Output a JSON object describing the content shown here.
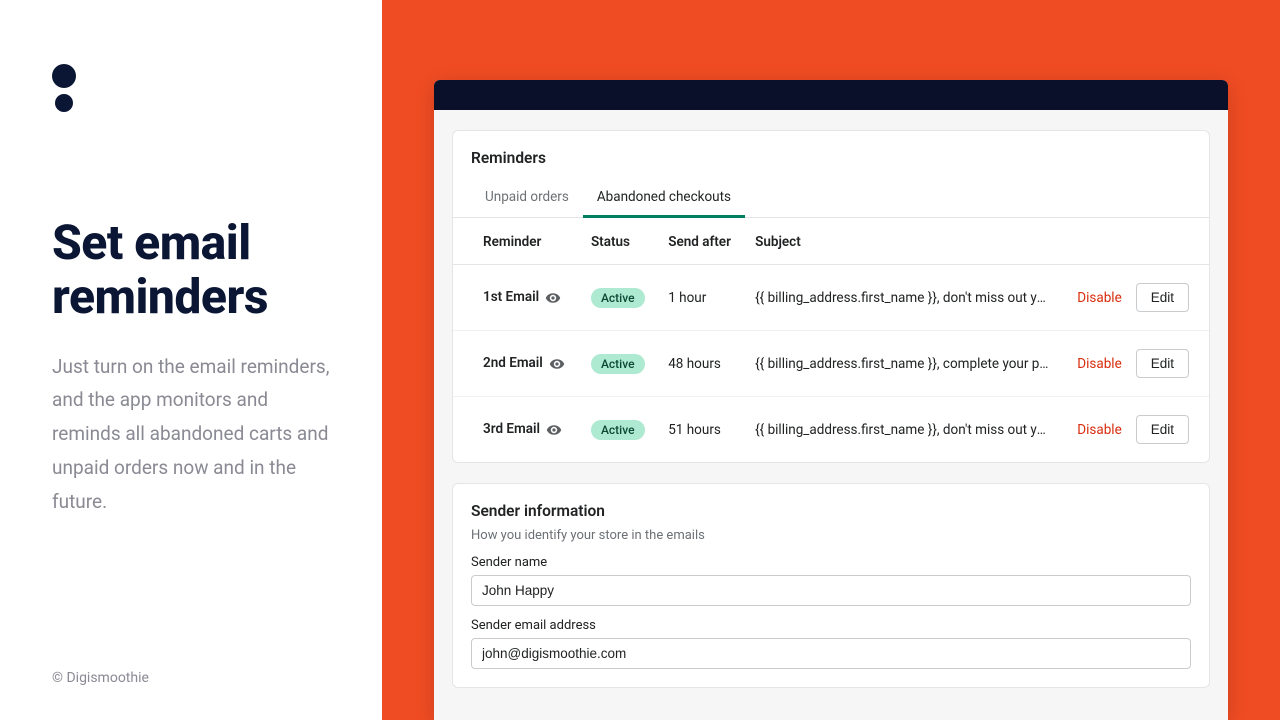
{
  "hero": {
    "title": "Set email reminders",
    "desc": "Just turn on the email reminders, and the app monitors and reminds all abandoned carts and unpaid orders now and in the future.",
    "copyright": "© Digismoothie"
  },
  "reminders_card": {
    "title": "Reminders",
    "tabs": {
      "unpaid": "Unpaid orders",
      "abandoned": "Abandoned checkouts"
    },
    "columns": {
      "reminder": "Reminder",
      "status": "Status",
      "send_after": "Send after",
      "subject": "Subject"
    },
    "rows": [
      {
        "name": "1st Email",
        "status": "Active",
        "send_after": "1 hour",
        "subject": "{{ billing_address.first_name }}, don't miss out your items!",
        "disable": "Disable",
        "edit": "Edit"
      },
      {
        "name": "2nd Email",
        "status": "Active",
        "send_after": "48 hours",
        "subject": "{{ billing_address.first_name }}, complete your purchase in a fe...",
        "disable": "Disable",
        "edit": "Edit"
      },
      {
        "name": "3rd Email",
        "status": "Active",
        "send_after": "51 hours",
        "subject": "{{ billing_address.first_name }}, don't miss out your items!",
        "disable": "Disable",
        "edit": "Edit"
      }
    ]
  },
  "sender_card": {
    "title": "Sender information",
    "subtitle": "How you identify your store in the emails",
    "name_label": "Sender name",
    "name_value": "John Happy",
    "email_label": "Sender email address",
    "email_value": "john@digismoothie.com"
  }
}
